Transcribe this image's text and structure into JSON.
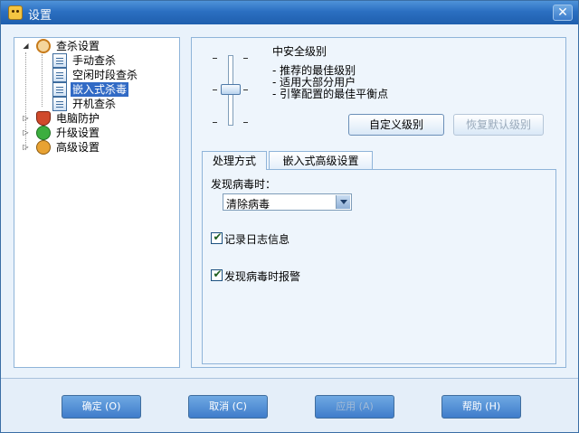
{
  "window": {
    "title": "设置",
    "close_label": "✕"
  },
  "tree": {
    "items": [
      {
        "label": "查杀设置"
      },
      {
        "label": "手动查杀"
      },
      {
        "label": "空闲时段查杀"
      },
      {
        "label": "嵌入式杀毒"
      },
      {
        "label": "开机查杀"
      },
      {
        "label": "电脑防护"
      },
      {
        "label": "升级设置"
      },
      {
        "label": "高级设置"
      }
    ],
    "selected": "嵌入式杀毒"
  },
  "security_level": {
    "title": "中安全级别",
    "descriptions": [
      "- 推荐的最佳级别",
      "- 适用大部分用户",
      "- 引擎配置的最佳平衡点"
    ],
    "custom_button": "自定义级别",
    "restore_button": "恢复默认级别"
  },
  "tabs": [
    {
      "label": "处理方式"
    },
    {
      "label": "嵌入式高级设置"
    }
  ],
  "processing": {
    "found_label": "发现病毒时：",
    "action_value": "清除病毒",
    "log_label": "记录日志信息",
    "log_checked": true,
    "alarm_label": "发现病毒时报警",
    "alarm_checked": true
  },
  "buttons": {
    "ok": "确定 (O)",
    "cancel": "取消 (C)",
    "apply": "应用 (A)",
    "help": "帮助 (H)"
  }
}
